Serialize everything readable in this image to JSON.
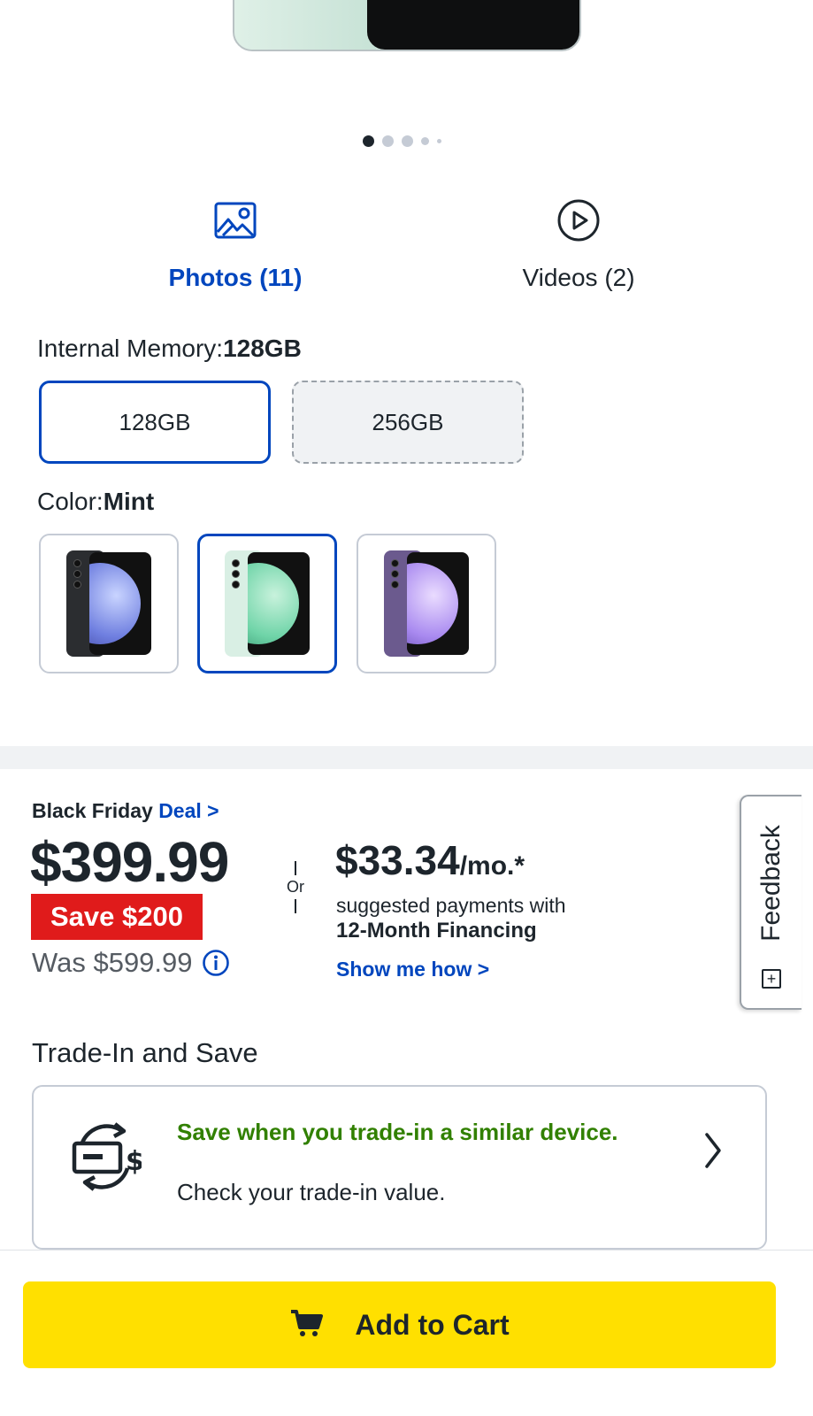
{
  "media_tabs": {
    "photos_label": "Photos (11)",
    "videos_label": "Videos (2)",
    "photos_icon": "image-icon",
    "videos_icon": "play-circle-icon"
  },
  "carousel": {
    "total_dots": 5,
    "active_index": 0
  },
  "memory": {
    "label": "Internal Memory:",
    "selected": "128GB",
    "options": [
      "128GB",
      "256GB"
    ]
  },
  "color": {
    "label": "Color:",
    "selected": "Mint",
    "options": [
      "Graphite",
      "Mint",
      "Purple"
    ]
  },
  "price": {
    "deal_prefix": "Black Friday",
    "deal_link": "Deal >",
    "current": "$399.99",
    "save_badge": "Save $200",
    "was": "Was $599.99",
    "or": "Or"
  },
  "financing": {
    "monthly_amount": "$33.34",
    "monthly_suffix": "/mo.*",
    "suggested": "suggested payments with",
    "plan": "12-Month Financing",
    "link": "Show me how >"
  },
  "feedback": {
    "label": "Feedback",
    "icon": "+"
  },
  "trade_in": {
    "title": "Trade-In and Save",
    "headline": "Save when you trade-in a similar device.",
    "subtext": "Check your trade-in value.",
    "icon": "trade-in-cycle-icon"
  },
  "cart": {
    "label": "Add to Cart",
    "icon": "cart-icon"
  },
  "colors": {
    "brand_blue": "#0046be",
    "save_red": "#e01b1b",
    "trade_green": "#318000",
    "cart_yellow": "#ffe000"
  }
}
